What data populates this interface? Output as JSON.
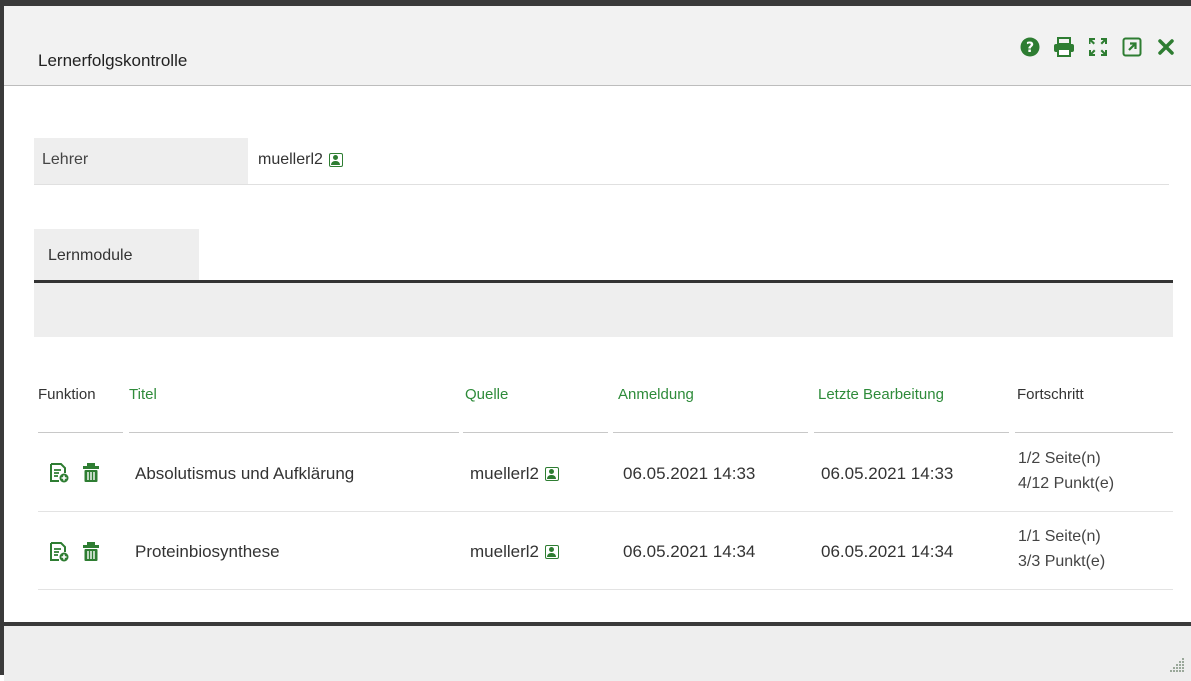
{
  "window": {
    "title": "Lernerfolgskontrolle",
    "icons": [
      "help-icon",
      "print-icon",
      "fullscreen-icon",
      "open-external-icon",
      "close-icon"
    ]
  },
  "teacher": {
    "label": "Lehrer",
    "value": "muellerl2"
  },
  "tabs": [
    {
      "label": "Lernmodule"
    }
  ],
  "table": {
    "headers": {
      "function": "Funktion",
      "title": "Titel",
      "source": "Quelle",
      "registration": "Anmeldung",
      "last_edit": "Letzte Bearbeitung",
      "progress": "Fortschritt"
    },
    "rows": [
      {
        "title": "Absolutismus und Aufklärung",
        "source": "muellerl2",
        "registration": "06.05.2021 14:33",
        "last_edit": "06.05.2021 14:33",
        "progress_pages": "1/2 Seite(n)",
        "progress_points": "4/12 Punkt(e)"
      },
      {
        "title": "Proteinbiosynthese",
        "source": "muellerl2",
        "registration": "06.05.2021 14:34",
        "last_edit": "06.05.2021 14:34",
        "progress_pages": "1/1 Seite(n)",
        "progress_points": "3/3 Punkt(e)"
      }
    ]
  },
  "colors": {
    "accent_green": "#2e8b3a",
    "icon_green": "#2e7d32",
    "border_dark": "#3a3a3a",
    "panel_gray": "#eeeeee"
  }
}
